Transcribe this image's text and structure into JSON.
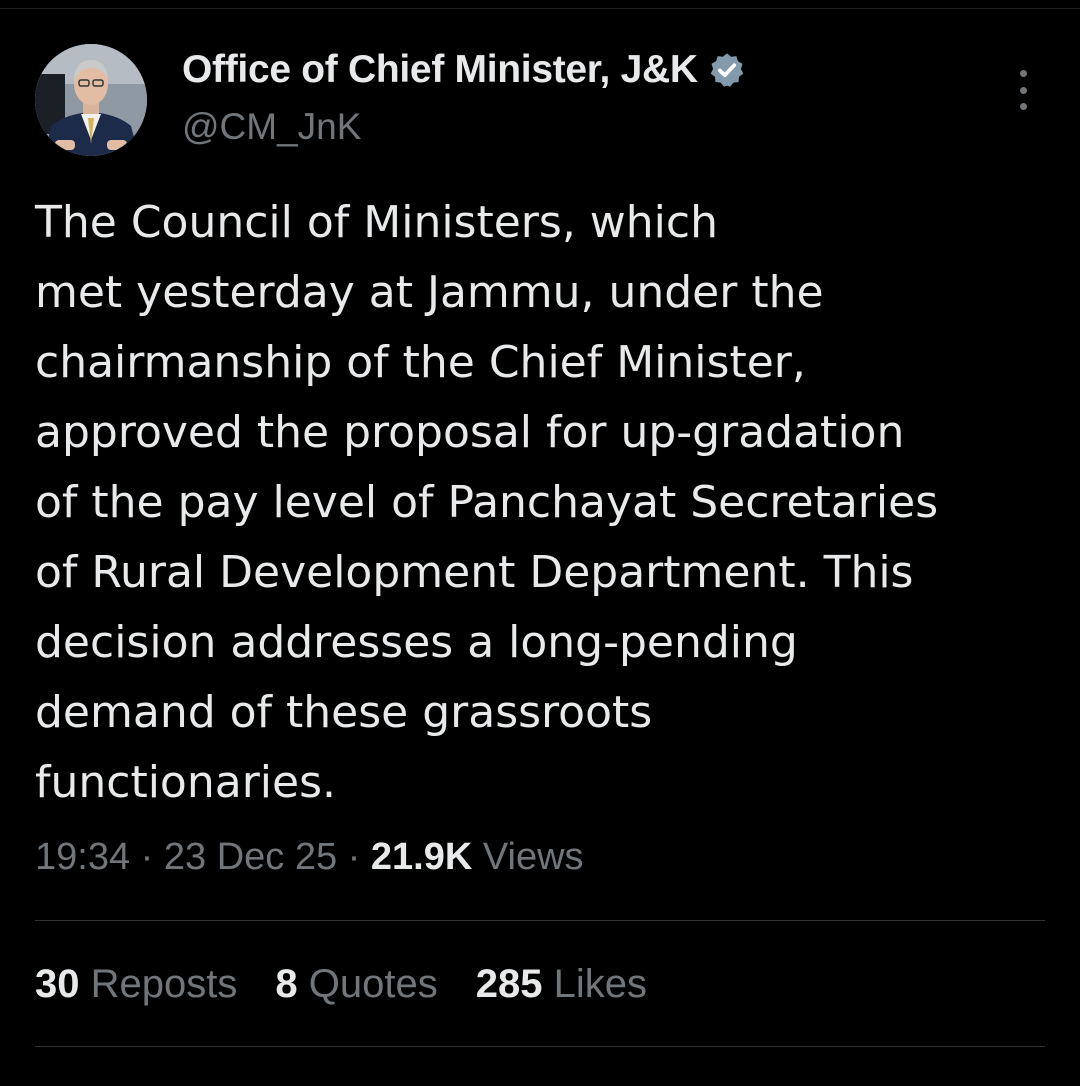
{
  "post": {
    "author": {
      "display_name": "Office of Chief Minister, J&K",
      "handle": "@CM_JnK",
      "verified_icon": "verified-badge-icon"
    },
    "text_lines": [
      "The Council of Ministers, which",
      "met yesterday at Jammu, under the",
      "chairmanship of the Chief Minister,",
      "approved the proposal for up-gradation",
      "of the pay level of Panchayat Secretaries",
      "of Rural Development Department. This",
      "decision addresses a long-pending",
      "demand of these grassroots",
      "functionaries."
    ],
    "time": "19:34",
    "separator": "·",
    "date": "23 Dec 25",
    "views_count": "21.9K",
    "views_label": "Views",
    "stats": {
      "reposts_count": "30",
      "reposts_label": "Reposts",
      "quotes_count": "8",
      "quotes_label": "Quotes",
      "likes_count": "285",
      "likes_label": "Likes"
    }
  },
  "colors": {
    "background": "#000000",
    "primary_text": "#e7e9ea",
    "secondary_text": "#71767b",
    "divider": "#2f3336"
  }
}
